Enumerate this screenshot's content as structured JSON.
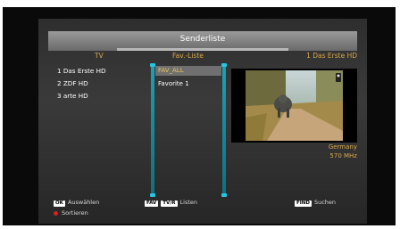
{
  "title": "Senderliste",
  "columns": {
    "left": "TV",
    "middle": "Fav.-Liste",
    "right": "1 Das Erste HD"
  },
  "channels": [
    "1 Das Erste HD",
    "2 ZDF HD",
    "3 arte HD"
  ],
  "fav_lists": [
    "FAV_ALL",
    "Favorite 1"
  ],
  "preview": {
    "country": "Germany",
    "frequency": "570 MHz"
  },
  "footer": {
    "ok_key": "OK",
    "ok_label": "Auswählen",
    "fav_key": "FAV",
    "tvr_key": "TV/R",
    "lists_label": "Listen",
    "find_key": "FIND",
    "find_label": "Suchen",
    "sort_label": "Sortieren"
  },
  "colors": {
    "accent": "#d9a84a",
    "selection": "#6f6f6f",
    "scrollbar": "#1aa3b8"
  }
}
